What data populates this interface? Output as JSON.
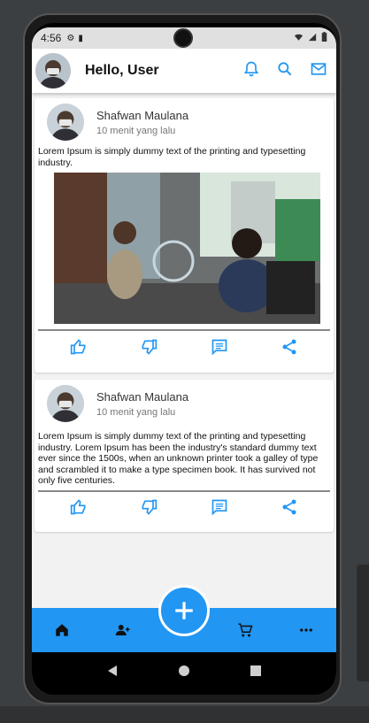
{
  "status_bar": {
    "time": "4:56"
  },
  "app_bar": {
    "title": "Hello, User"
  },
  "posts": [
    {
      "author": "Shafwan Maulana",
      "time_ago": "10 menit yang lalu",
      "text": "Lorem Ipsum is simply dummy text of the printing and typesetting industry.",
      "has_photo": true
    },
    {
      "author": "Shafwan Maulana",
      "time_ago": "10 menit yang lalu",
      "text": "Lorem Ipsum is simply dummy text of the printing and typesetting industry. Lorem Ipsum has been the industry's standard dummy text ever since the 1500s, when an unknown printer took a galley of type and scrambled it to make a type specimen book. It has survived not only five centuries.",
      "has_photo": false
    }
  ],
  "reaction_icons": [
    "thumb-up-icon",
    "thumb-down-icon",
    "comment-icon",
    "share-icon"
  ],
  "bottom_nav": [
    "home-icon",
    "friends-icon",
    "add-icon",
    "cart-icon",
    "more-icon"
  ],
  "colors": {
    "accent": "#2196f3",
    "appbar": "#ffffff",
    "background": "#f2f2f2"
  }
}
